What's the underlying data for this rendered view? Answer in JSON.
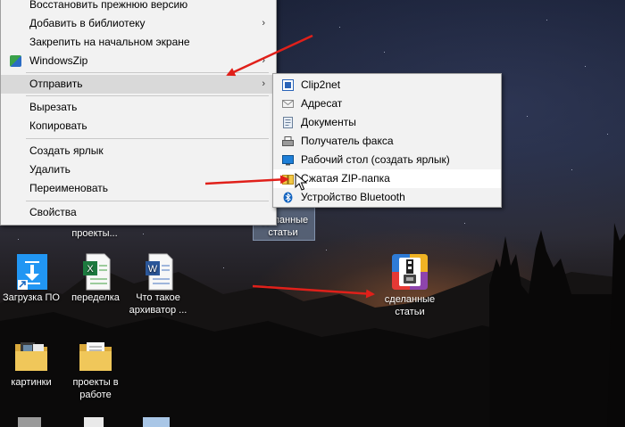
{
  "context_menu": {
    "items": [
      {
        "label": "Восстановить прежнюю версию",
        "has_submenu": false
      },
      {
        "label": "Добавить в библиотеку",
        "has_submenu": true
      },
      {
        "label": "Закрепить на начальном экране",
        "has_submenu": false
      },
      {
        "label": "WindowsZip",
        "has_submenu": true,
        "icon": "windowszip-icon"
      },
      {
        "label": "Отправить",
        "has_submenu": true,
        "highlighted": true
      },
      {
        "label": "Вырезать",
        "has_submenu": false
      },
      {
        "label": "Копировать",
        "has_submenu": false
      },
      {
        "label": "Создать ярлык",
        "has_submenu": false
      },
      {
        "label": "Удалить",
        "has_submenu": false
      },
      {
        "label": "Переименовать",
        "has_submenu": false
      },
      {
        "label": "Свойства",
        "has_submenu": false
      }
    ],
    "submenu_arrow": "›"
  },
  "send_to_menu": {
    "items": [
      {
        "label": "Clip2net",
        "icon": "clip2net-icon"
      },
      {
        "label": "Адресат",
        "icon": "mail-recipient-icon"
      },
      {
        "label": "Документы",
        "icon": "documents-icon"
      },
      {
        "label": "Получатель факса",
        "icon": "fax-icon"
      },
      {
        "label": "Рабочий стол (создать ярлык)",
        "icon": "desktop-icon"
      },
      {
        "label": "Сжатая ZIP-папка",
        "icon": "zip-folder-icon",
        "highlighted": true
      },
      {
        "label": "Устройство Bluetooth",
        "icon": "bluetooth-icon"
      }
    ]
  },
  "desktop": {
    "partial_selected_label": "сделанные\nстатьи",
    "partial_label_top": "проекты...",
    "icons": [
      {
        "label": "Загрузка ПО",
        "icon": "download-shortcut-icon"
      },
      {
        "label": "переделка",
        "icon": "excel-file-icon"
      },
      {
        "label": "Что такое архиватор ...",
        "icon": "word-file-icon"
      },
      {
        "label": "сделанные статьи",
        "icon": "zip-archive-icon"
      },
      {
        "label": "картинки",
        "icon": "folder-pictures-icon"
      },
      {
        "label": "проекты в работе",
        "icon": "folder-icon"
      }
    ]
  },
  "colors": {
    "annotation_arrow": "#e0201a",
    "menu_bg": "#f2f2f2",
    "menu_highlight": "#d9d9d9"
  }
}
